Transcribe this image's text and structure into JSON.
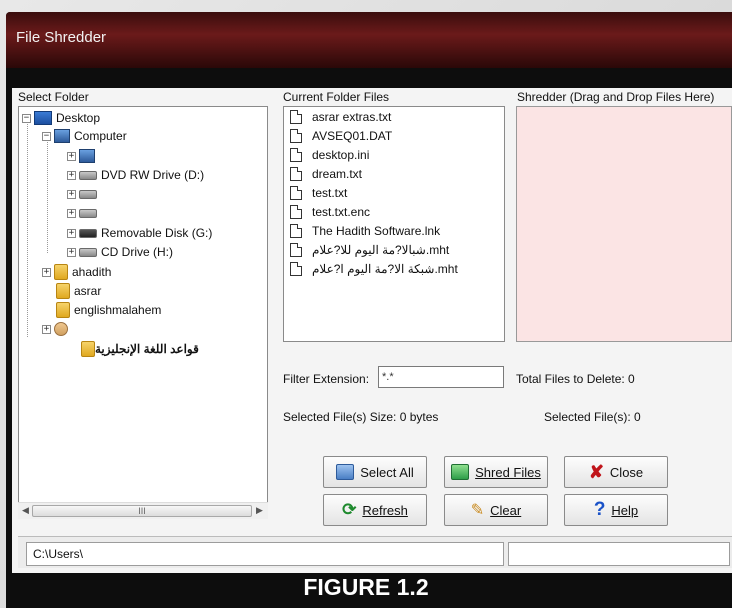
{
  "window": {
    "title": "File Shredder"
  },
  "labels": {
    "select_folder": "Select Folder",
    "current_files": "Current Folder Files",
    "shredder": "Shredder (Drag and Drop Files Here)",
    "filter_extension": "Filter Extension:",
    "total_files": "Total Files to Delete:  0",
    "selected_size": "Selected File(s) Size:  0 bytes",
    "selected_count": "Selected File(s):  0"
  },
  "filter": {
    "value": "*.*"
  },
  "tree": [
    {
      "label": "Desktop",
      "icon": "desktop-icon"
    },
    {
      "label": "Computer",
      "icon": "computer-icon"
    },
    {
      "label": "",
      "icon": "drive-icon"
    },
    {
      "label": "DVD RW Drive (D:)",
      "icon": "dvd-drive-icon"
    },
    {
      "label": "",
      "icon": "drive-icon"
    },
    {
      "label": "",
      "icon": "drive-icon"
    },
    {
      "label": "Removable Disk (G:)",
      "icon": "removable-disk-icon"
    },
    {
      "label": "CD Drive (H:)",
      "icon": "cd-drive-icon"
    },
    {
      "label": "ahadith",
      "icon": "folder-icon"
    },
    {
      "label": "asrar",
      "icon": "folder-icon"
    },
    {
      "label": "englishmalahem",
      "icon": "folder-icon"
    },
    {
      "label": "",
      "icon": "user-folder-icon"
    },
    {
      "label": "قواعد اللغة الإنجليزية",
      "icon": "folder-icon"
    }
  ],
  "files": [
    "asrar extras.txt",
    "AVSEQ01.DAT",
    "desktop.ini",
    "dream.txt",
    "test.txt",
    "test.txt.enc",
    "The Hadith Software.lnk",
    "شبالا?مة اليوم للا?علام.mht",
    "شبكة الا?مة اليوم ا?علام.mht"
  ],
  "buttons": {
    "select_all": "Select All",
    "shred_files": "Shred Files",
    "close": "Close",
    "refresh": "Refresh",
    "clear": "Clear",
    "help": "Help"
  },
  "scrollbar": {
    "thumb_grip": "III"
  },
  "status": {
    "path": "C:\\Users\\"
  },
  "caption": "FIGURE 1.2",
  "colors": {
    "shredder_bg": "#fbe4e4",
    "titlebar": "#6b1a1a",
    "close_x": "#c0141a",
    "help_q": "#1a52c8"
  }
}
